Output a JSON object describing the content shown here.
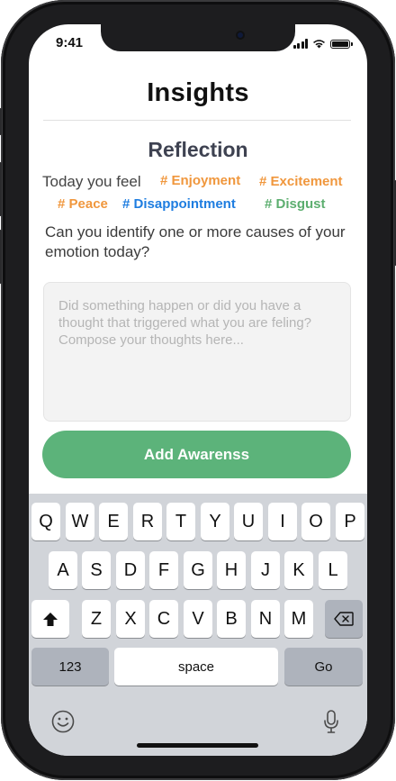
{
  "status": {
    "time": "9:41"
  },
  "header": {
    "title": "Insights"
  },
  "reflection": {
    "subtitle": "Reflection",
    "prompt_prefix": "Today you feel",
    "tags": [
      {
        "label": "# Enjoyment",
        "color": "#f0973d"
      },
      {
        "label": "# Excitement",
        "color": "#f0973d"
      },
      {
        "label": "# Peace",
        "color": "#f0973d"
      },
      {
        "label": "# Disappointment",
        "color": "#1e7de0"
      },
      {
        "label": "# Disgust",
        "color": "#5cae6f"
      }
    ],
    "question": "Can you identify one or more causes of your emotion today?",
    "input_placeholder": "Did something happen or did you have a thought that triggered what you are feling?\nCompose your thoughts here...",
    "button_label": "Add Awarenss"
  },
  "keyboard": {
    "row1": [
      "Q",
      "W",
      "E",
      "R",
      "T",
      "Y",
      "U",
      "I",
      "O",
      "P"
    ],
    "row2": [
      "A",
      "S",
      "D",
      "F",
      "G",
      "H",
      "J",
      "K",
      "L"
    ],
    "row3": [
      "Z",
      "X",
      "C",
      "V",
      "B",
      "N",
      "M"
    ],
    "numbers_label": "123",
    "space_label": "space",
    "go_label": "Go",
    "shift_icon": "shift-icon",
    "backspace_icon": "backspace-icon",
    "emoji_icon": "emoji-icon",
    "mic_icon": "microphone-icon"
  },
  "colors": {
    "accent": "#5cb37a",
    "tag_orange": "#f0973d",
    "tag_blue": "#1e7de0",
    "tag_green": "#5cae6f"
  }
}
